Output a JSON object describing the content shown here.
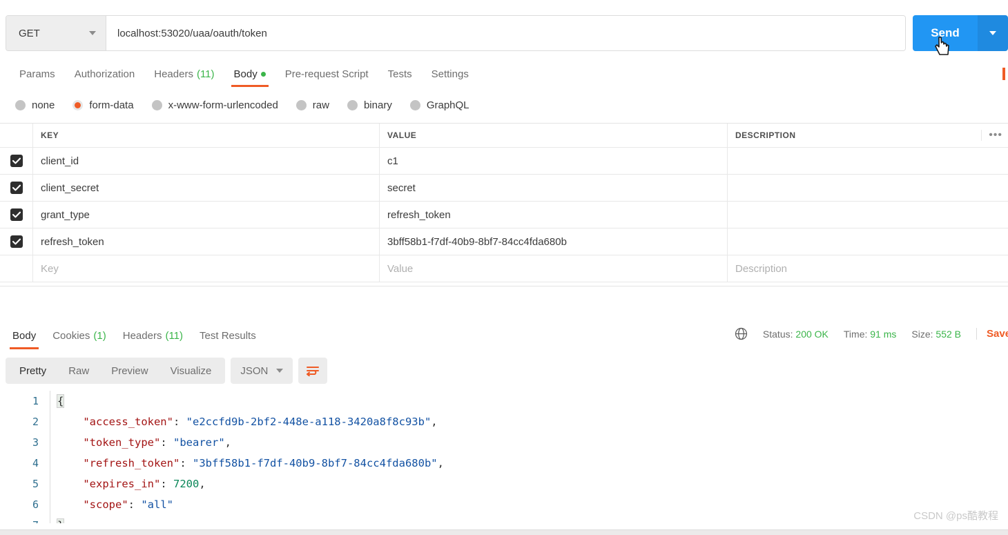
{
  "request": {
    "method": "GET",
    "url": "localhost:53020/uaa/oauth/token",
    "send_label": "Send",
    "tabs": [
      {
        "label": "Params",
        "count": "",
        "dot": false
      },
      {
        "label": "Authorization",
        "count": "",
        "dot": false
      },
      {
        "label": "Headers",
        "count": "(11)",
        "dot": false
      },
      {
        "label": "Body",
        "count": "",
        "dot": true
      },
      {
        "label": "Pre-request Script",
        "count": "",
        "dot": false
      },
      {
        "label": "Tests",
        "count": "",
        "dot": false
      },
      {
        "label": "Settings",
        "count": "",
        "dot": false
      }
    ],
    "body_types": [
      {
        "label": "none",
        "selected": false
      },
      {
        "label": "form-data",
        "selected": true
      },
      {
        "label": "x-www-form-urlencoded",
        "selected": false
      },
      {
        "label": "raw",
        "selected": false
      },
      {
        "label": "binary",
        "selected": false
      },
      {
        "label": "GraphQL",
        "selected": false
      }
    ],
    "table": {
      "headers": {
        "key": "KEY",
        "value": "VALUE",
        "description": "DESCRIPTION"
      },
      "bulk_edit_icon": "•••",
      "rows": [
        {
          "checked": true,
          "key": "client_id",
          "value": "c1",
          "description": ""
        },
        {
          "checked": true,
          "key": "client_secret",
          "value": "secret",
          "description": ""
        },
        {
          "checked": true,
          "key": "grant_type",
          "value": "refresh_token",
          "description": ""
        },
        {
          "checked": true,
          "key": "refresh_token",
          "value": "3bff58b1-f7df-40b9-8bf7-84cc4fda680b",
          "description": ""
        }
      ],
      "placeholder_row": {
        "key": "Key",
        "value": "Value",
        "description": "Description"
      }
    }
  },
  "response": {
    "tabs": [
      {
        "label": "Body",
        "count": ""
      },
      {
        "label": "Cookies",
        "count": "(1)"
      },
      {
        "label": "Headers",
        "count": "(11)"
      },
      {
        "label": "Test Results",
        "count": ""
      }
    ],
    "meta": {
      "status_label": "Status:",
      "status_value": "200 OK",
      "time_label": "Time:",
      "time_value": "91 ms",
      "size_label": "Size:",
      "size_value": "552 B",
      "save_label": "Save"
    },
    "view_modes": [
      "Pretty",
      "Raw",
      "Preview",
      "Visualize"
    ],
    "active_view": "Pretty",
    "format": "JSON",
    "body": {
      "access_token": "e2ccfd9b-2bf2-448e-a118-3420a8f8c93b",
      "token_type": "bearer",
      "refresh_token": "3bff58b1-f7df-40b9-8bf7-84cc4fda680b",
      "expires_in": "7200",
      "scope": "all"
    },
    "code_lines": [
      "1",
      "2",
      "3",
      "4",
      "5",
      "6"
    ]
  },
  "watermark": "CSDN @ps酷教程",
  "colors": {
    "accent_orange": "#ef5b25",
    "send_blue": "#2196f3",
    "green": "#3bb54a",
    "json_key": "#a31515",
    "json_string": "#1352a3",
    "json_number": "#098658"
  }
}
